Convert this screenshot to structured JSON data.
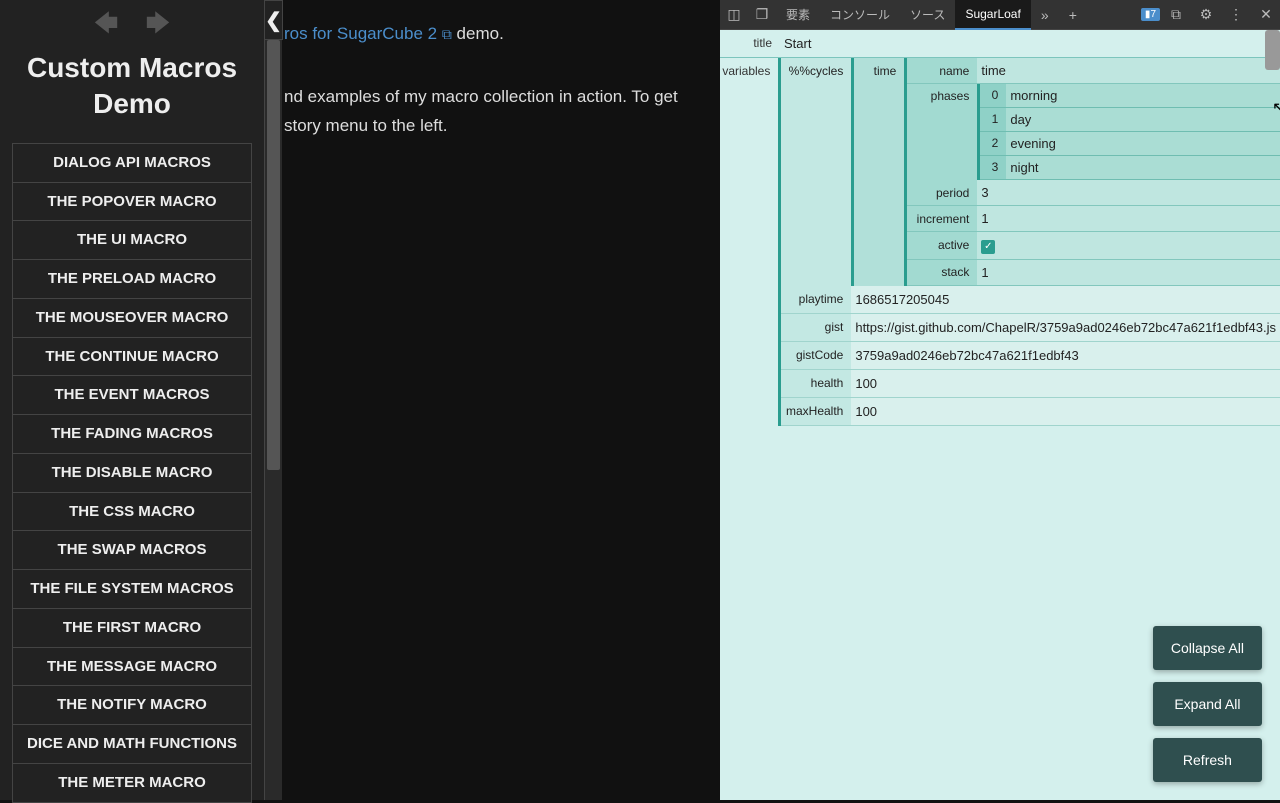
{
  "sidebar": {
    "title": "Custom Macros Demo",
    "items": [
      "DIALOG API MACROS",
      "THE POPOVER MACRO",
      "THE UI MACRO",
      "THE PRELOAD MACRO",
      "THE MOUSEOVER MACRO",
      "THE CONTINUE MACRO",
      "THE EVENT MACROS",
      "THE FADING MACROS",
      "THE DISABLE MACRO",
      "THE CSS MACRO",
      "THE SWAP MACROS",
      "THE FILE SYSTEM MACROS",
      "THE FIRST MACRO",
      "THE MESSAGE MACRO",
      "THE NOTIFY MACRO",
      "DICE AND MATH FUNCTIONS",
      "THE METER MACRO"
    ]
  },
  "main": {
    "line1_link": "ros for SugarCube 2",
    "line1_after": " demo.",
    "para": "nd examples of my macro collection in action. To get story menu to the left."
  },
  "devtools": {
    "tabs": {
      "elements": "要素",
      "console": "コンソール",
      "sources": "ソース",
      "sugarloaf": "SugarLoaf"
    },
    "badge": "7"
  },
  "inspector": {
    "title_label": "title",
    "title_value": "Start",
    "variables_label": "variables",
    "cycles_key": "%%cycles",
    "time_key": "time",
    "time": {
      "name_label": "name",
      "name_value": "time",
      "phases_label": "phases",
      "phases": [
        {
          "idx": "0",
          "val": "morning"
        },
        {
          "idx": "1",
          "val": "day"
        },
        {
          "idx": "2",
          "val": "evening"
        },
        {
          "idx": "3",
          "val": "night"
        }
      ],
      "period_label": "period",
      "period_value": "3",
      "increment_label": "increment",
      "increment_value": "1",
      "active_label": "active",
      "stack_label": "stack",
      "stack_value": "1"
    },
    "vars": [
      {
        "key": "playtime",
        "val": "1686517205045"
      },
      {
        "key": "gist",
        "val": "https://gist.github.com/ChapelR/3759a9ad0246eb72bc47a621f1edbf43.js"
      },
      {
        "key": "gistCode",
        "val": "3759a9ad0246eb72bc47a621f1edbf43"
      },
      {
        "key": "health",
        "val": "100"
      },
      {
        "key": "maxHealth",
        "val": "100"
      }
    ]
  },
  "buttons": {
    "collapse": "Collapse All",
    "expand": "Expand All",
    "refresh": "Refresh"
  }
}
